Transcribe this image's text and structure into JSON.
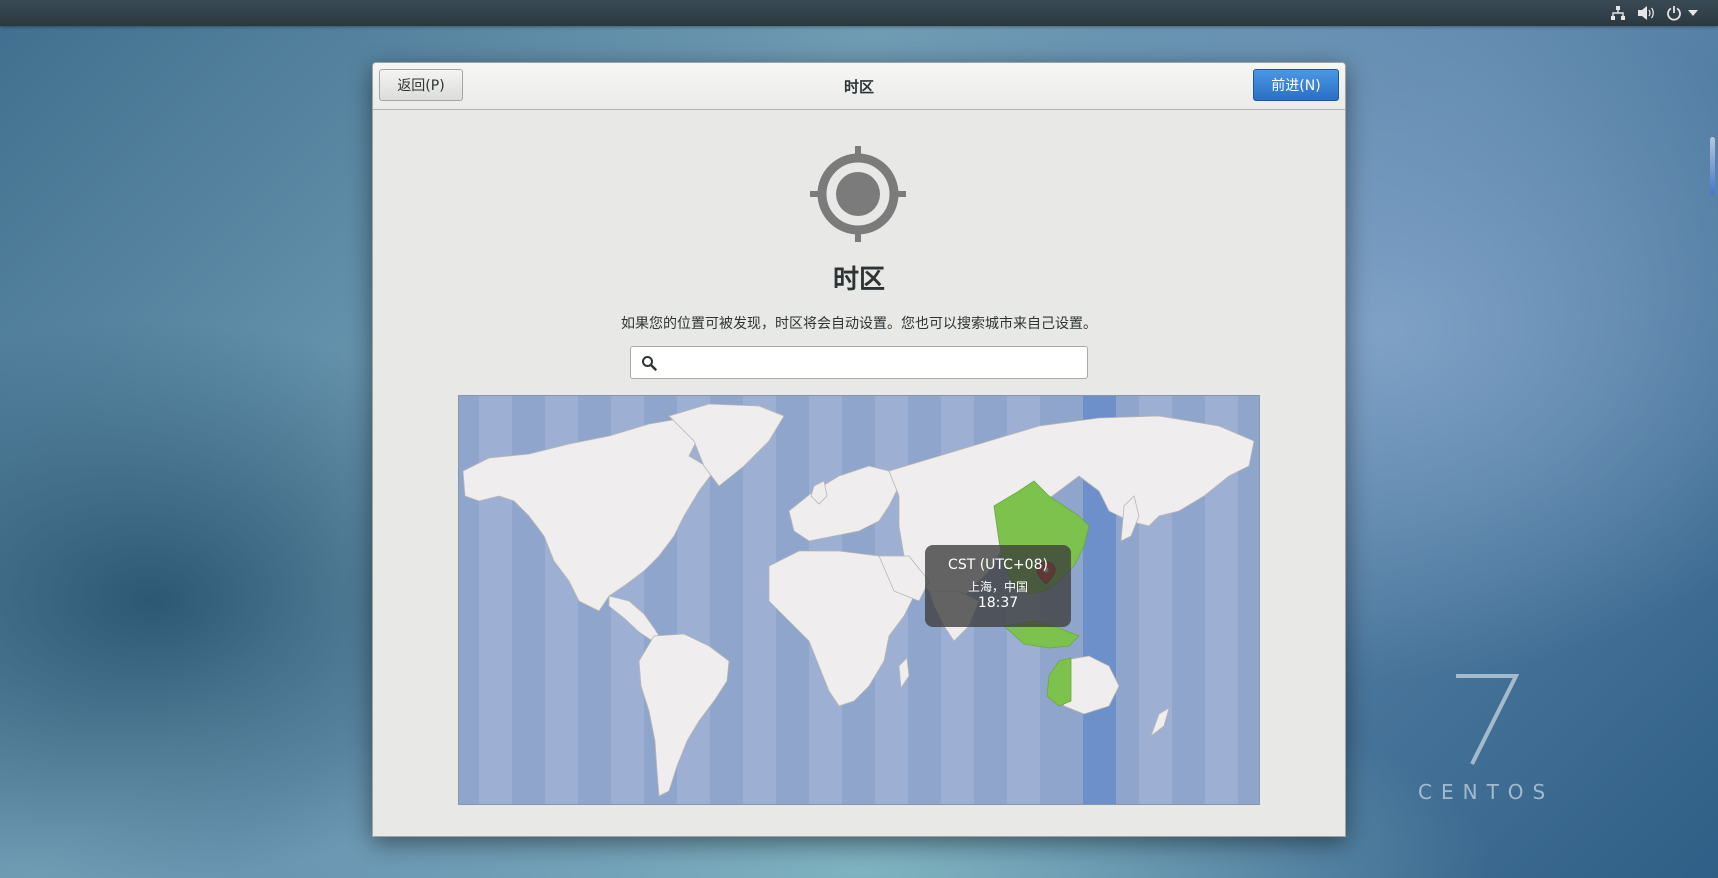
{
  "topbar": {
    "icons": [
      "network-icon",
      "volume-icon",
      "power-icon",
      "chevron-down-icon"
    ]
  },
  "brand": {
    "version": "7",
    "name": "CENTOS"
  },
  "dialog": {
    "header": {
      "back_label": "返回(P)",
      "title": "时区",
      "next_label": "前进(N)"
    },
    "hero_icon": "location-crosshair-icon",
    "page_title": "时区",
    "description": "如果您的位置可被发现，时区将会自动设置。您也可以搜索城市来自己设置。",
    "search": {
      "value": "",
      "placeholder": ""
    },
    "map": {
      "selected": {
        "zone": "CST (UTC+08)",
        "city": "上海，中国",
        "time": "18:37"
      }
    }
  },
  "colors": {
    "ocean": "#8fa5cc",
    "land": "#efeded",
    "selected_zone": "#7dc24c",
    "selected_band": "#6d8fca",
    "accent": "#2a6fc4",
    "pin": "#d62d20"
  }
}
